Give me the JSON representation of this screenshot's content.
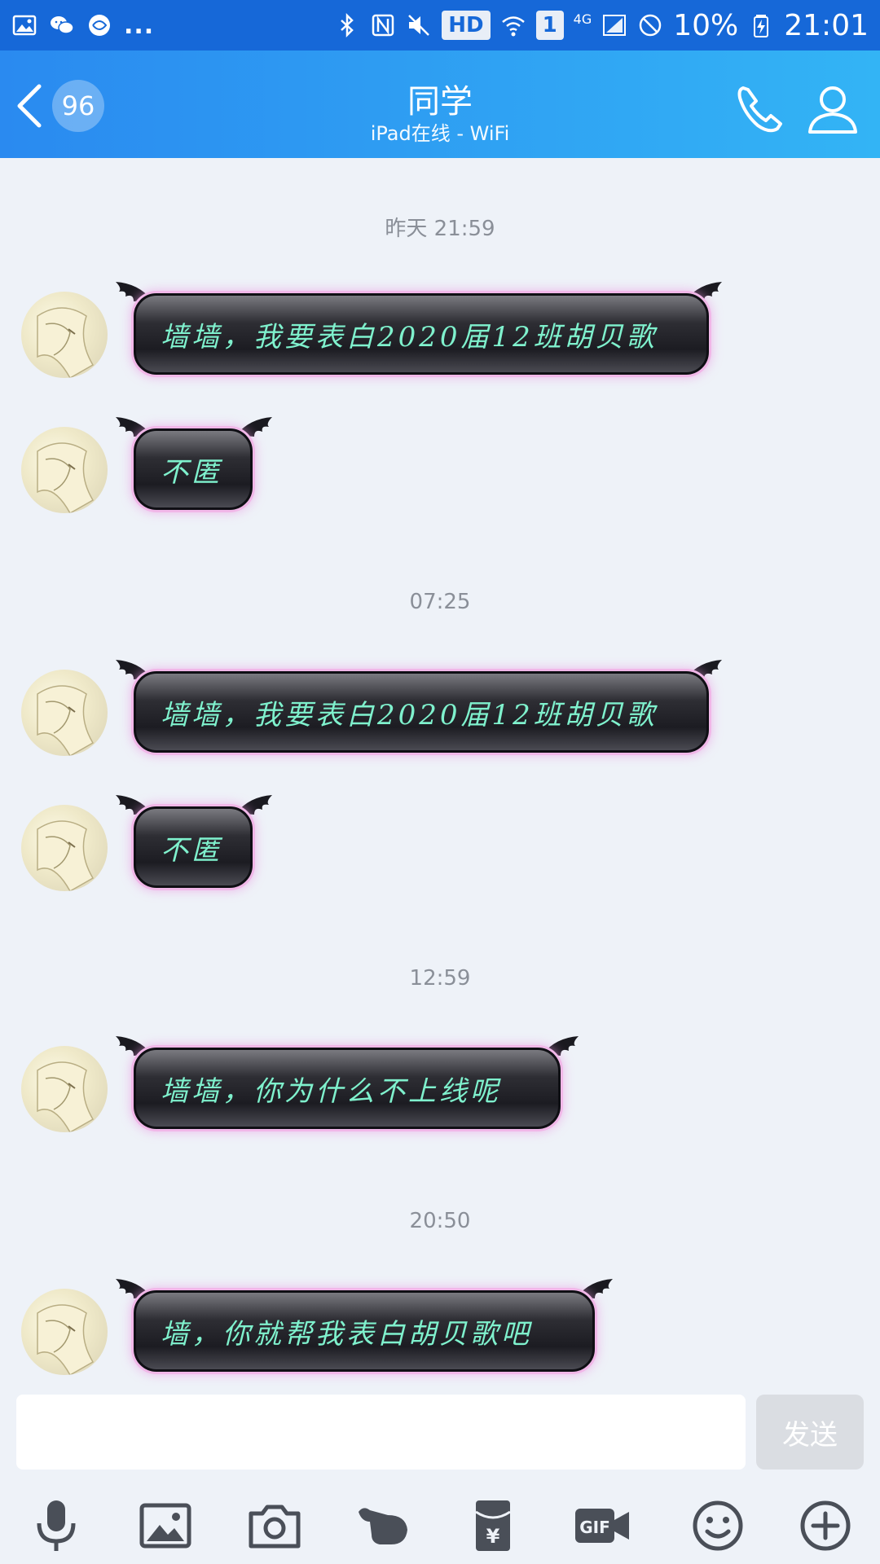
{
  "status_bar": {
    "dots": "...",
    "hd": "HD",
    "sim": "1",
    "network": "4G",
    "battery": "10%",
    "time": "21:01"
  },
  "header": {
    "back_count": "96",
    "title": "同学",
    "subtitle": "iPad在线 - WiFi"
  },
  "messages": [
    {
      "type": "time",
      "text": "昨天 21:59"
    },
    {
      "type": "msg",
      "text": "墙墙，我要表白2020届12班胡贝歌"
    },
    {
      "type": "msg",
      "text": "不匿"
    },
    {
      "type": "time",
      "text": "07:25"
    },
    {
      "type": "msg",
      "text": "墙墙，我要表白2020届12班胡贝歌"
    },
    {
      "type": "msg",
      "text": "不匿"
    },
    {
      "type": "time",
      "text": "12:59"
    },
    {
      "type": "msg",
      "text": "墙墙，你为什么不上线呢"
    },
    {
      "type": "time",
      "text": "20:50"
    },
    {
      "type": "msg",
      "text": "墙，你就帮我表白胡贝歌吧"
    }
  ],
  "input": {
    "value": "",
    "send_label": "发送"
  },
  "toolbar": {
    "items": [
      "microphone-icon",
      "image-icon",
      "camera-icon",
      "poke-icon",
      "red-packet-icon",
      "gif-icon",
      "emoji-icon",
      "plus-icon"
    ],
    "gif_label": "GIF",
    "yen": "¥"
  },
  "colors": {
    "header_start": "#2a8af0",
    "header_end": "#33b4f5",
    "bubble_text": "#7ff1cd",
    "bubble_glow": "#f1b7e8",
    "background": "#eef2f8"
  }
}
